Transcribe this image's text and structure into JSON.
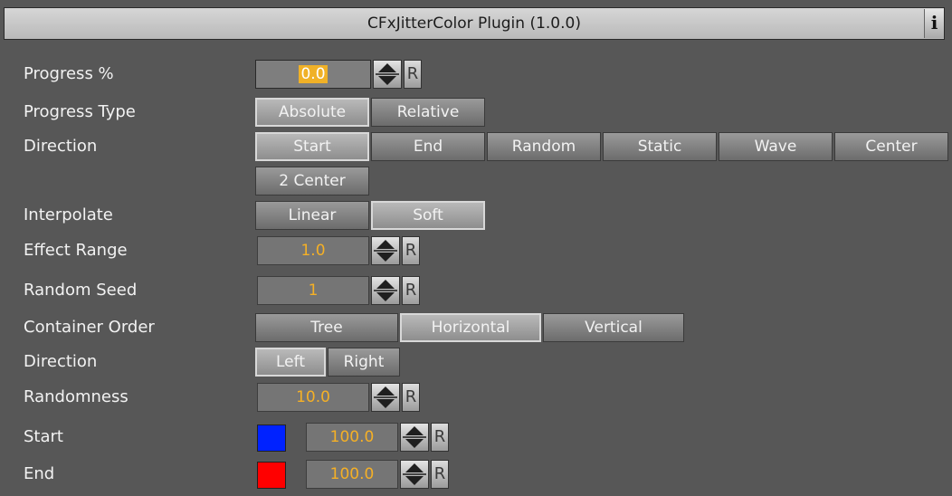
{
  "title": "CFxJitterColor Plugin (1.0.0)",
  "info_label": "i",
  "reset_label": "R",
  "progress": {
    "label": "Progress %",
    "value": "0.0"
  },
  "progress_type": {
    "label": "Progress Type",
    "options": [
      "Absolute",
      "Relative"
    ],
    "selected": "Absolute"
  },
  "direction1": {
    "label": "Direction",
    "options": [
      "Start",
      "End",
      "Random",
      "Static",
      "Wave",
      "Center",
      "2 Center"
    ],
    "selected": "Start"
  },
  "interpolate": {
    "label": "Interpolate",
    "options": [
      "Linear",
      "Soft"
    ],
    "selected": "Soft"
  },
  "effect_range": {
    "label": "Effect Range",
    "value": "1.0"
  },
  "random_seed": {
    "label": "Random Seed",
    "value": "1"
  },
  "container_order": {
    "label": "Container Order",
    "options": [
      "Tree",
      "Horizontal",
      "Vertical"
    ],
    "selected": "Horizontal"
  },
  "direction2": {
    "label": "Direction",
    "options": [
      "Left",
      "Right"
    ],
    "selected": "Left"
  },
  "randomness": {
    "label": "Randomness",
    "value": "10.0"
  },
  "start": {
    "label": "Start",
    "color": "#0022ff",
    "value": "100.0"
  },
  "end": {
    "label": "End",
    "color": "#ff0000",
    "value": "100.0"
  },
  "colors": {
    "background": "#575757",
    "value_text": "#f5b026",
    "highlight": "#f0b127"
  }
}
